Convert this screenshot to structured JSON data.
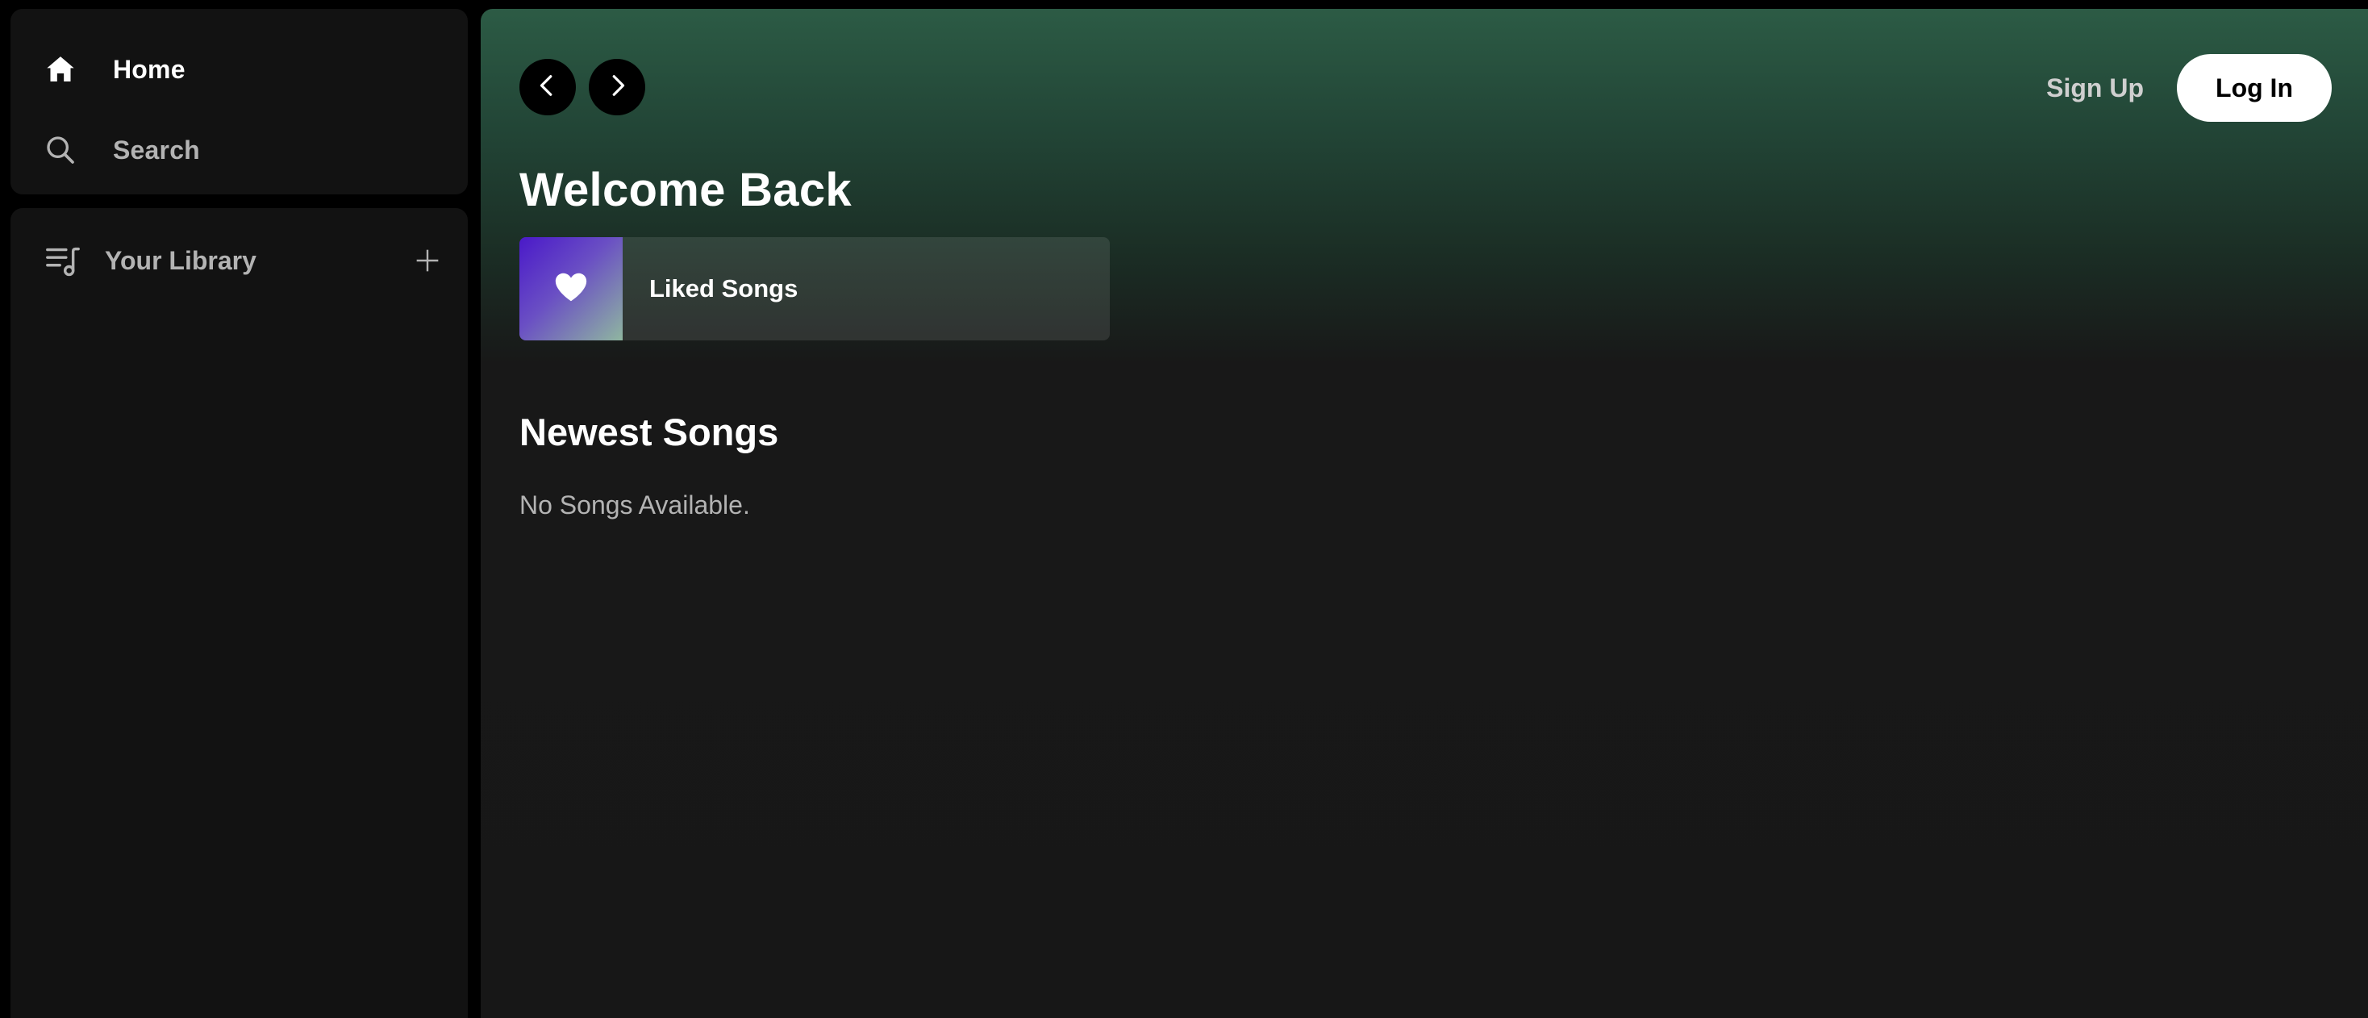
{
  "colors": {
    "app_background": "#000000",
    "panel_background": "#121212",
    "main_gradient_top": "#2c5b45",
    "main_background": "#171717",
    "text_primary": "#ffffff",
    "text_secondary": "#b3b3b3",
    "liked_songs_gradient": [
      "#4a19c9",
      "#8fb6a0"
    ]
  },
  "sidebar": {
    "nav": [
      {
        "label": "Home",
        "icon": "home-icon",
        "active": true
      },
      {
        "label": "Search",
        "icon": "search-icon",
        "active": false
      }
    ],
    "library": {
      "label": "Your Library",
      "icon": "library-icon",
      "add_icon": "plus-icon"
    }
  },
  "header": {
    "back_icon": "chevron-left-icon",
    "forward_icon": "chevron-right-icon",
    "sign_up_label": "Sign Up",
    "log_in_label": "Log In"
  },
  "main": {
    "title": "Welcome Back",
    "liked_songs": {
      "label": "Liked Songs",
      "icon": "heart-icon"
    },
    "newest_songs": {
      "title": "Newest Songs",
      "empty_message": "No Songs Available."
    }
  }
}
